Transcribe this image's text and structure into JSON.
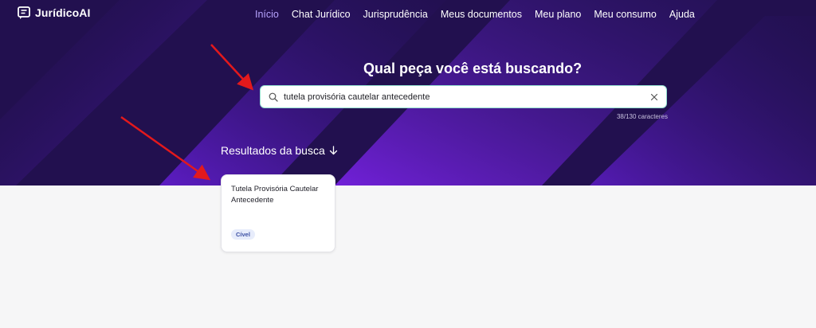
{
  "app": {
    "name": "JurídicoAI"
  },
  "nav": {
    "items": [
      {
        "label": "Início",
        "active": true
      },
      {
        "label": "Chat Jurídico"
      },
      {
        "label": "Jurisprudência"
      },
      {
        "label": "Meus documentos"
      },
      {
        "label": "Meu plano"
      },
      {
        "label": "Meu consumo"
      },
      {
        "label": "Ajuda"
      }
    ]
  },
  "hero": {
    "headline": "Qual peça você está buscando?",
    "search": {
      "value": "tutela provisória cautelar antecedente",
      "icon": "search-icon",
      "clear_icon": "close-icon"
    },
    "char_count": "38/130 caracteres"
  },
  "results": {
    "title": "Resultados da busca",
    "items": [
      {
        "title": "Tutela Provisória Cautelar Antecedente",
        "badge": "Cível"
      }
    ]
  },
  "colors": {
    "hero_background": "#22104f",
    "accent": "#7b2ff0",
    "nav_active": "#b7a4ff",
    "annotation_arrow": "#e3191c"
  }
}
